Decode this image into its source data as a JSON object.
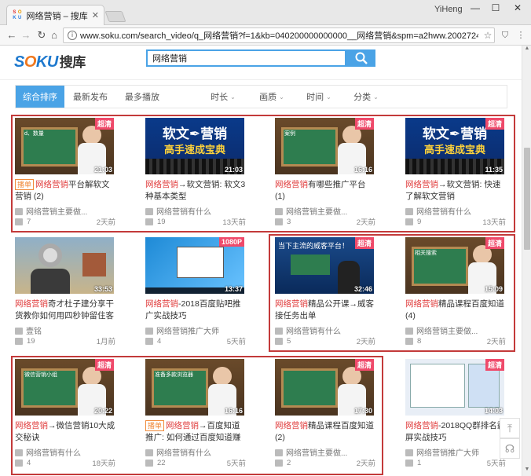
{
  "browser": {
    "tab_title": "网络营销 – 搜库",
    "favicon_letters": [
      "S",
      "O",
      "K",
      "U"
    ],
    "user_name": "YiHeng",
    "url": "www.soku.com/search_video/q_网络营销?f=1&kb=040200000000000__网络营销&spm=a2hww.20027244.#qheader_s..."
  },
  "site": {
    "logo_s": "S",
    "logo_o": "O",
    "logo_ku": "KU",
    "logo_cn": "搜库",
    "search_value": "网络营销"
  },
  "filters": [
    {
      "label": "综合排序",
      "active": true,
      "caret": false
    },
    {
      "label": "最新发布",
      "active": false,
      "caret": false
    },
    {
      "label": "最多播放",
      "active": false,
      "caret": false
    },
    {
      "label": "时长",
      "active": false,
      "caret": true
    },
    {
      "label": "画质",
      "active": false,
      "caret": true
    },
    {
      "label": "时间",
      "active": false,
      "caret": true
    },
    {
      "label": "分类",
      "active": false,
      "caret": true
    }
  ],
  "videos": [
    {
      "tag": "播单",
      "title_hl": "网络营销",
      "title_rest": "平台解软文营销 (2)",
      "author": "网络营销主要做...",
      "count": "7",
      "ago": "2天前",
      "badge": "超清",
      "duration": "21:03",
      "thumb_text": "d、数量",
      "thumb": "board"
    },
    {
      "tag": "",
      "title_hl": "网络营销",
      "title_rest": "→软文营销: 软文3种基本类型",
      "author": "网络营销有什么",
      "count": "19",
      "ago": "13天前",
      "badge": "",
      "duration": "21:03",
      "thumb_text": "软文✒营销",
      "thumb_text2": "高手速成宝典",
      "thumb": "banner"
    },
    {
      "tag": "",
      "title_hl": "网络营销",
      "title_rest": "有哪些推广平台 (1)",
      "author": "网络营销主要做...",
      "count": "3",
      "ago": "2天前",
      "badge": "超清",
      "duration": "16:16",
      "thumb_text": "案例",
      "thumb": "board"
    },
    {
      "tag": "",
      "title_hl": "网络营销",
      "title_rest": "→软文营销: 快速了解软文营销",
      "author": "网络营销有什么",
      "count": "9",
      "ago": "13天前",
      "badge": "超清",
      "duration": "11:35",
      "thumb_text": "软文✒营销",
      "thumb_text2": "高手速成宝典",
      "thumb": "banner"
    },
    {
      "tag": "",
      "title_hl": "网络营销",
      "title_rest": "奇才杜子建分享干货教你如何用四秒钟留住客",
      "author": "壹铭",
      "count": "19",
      "ago": "1月前",
      "badge": "",
      "duration": "33:53",
      "thumb_text": "",
      "thumb": "speaker"
    },
    {
      "tag": "",
      "title_hl": "网络营销",
      "title_rest": "-2018百度贴吧推广实战技巧",
      "author": "网络营销推广大师",
      "count": "4",
      "ago": "5天前",
      "badge": "1080P",
      "duration": "13:37",
      "thumb_text": "",
      "thumb": "desktop"
    },
    {
      "tag": "",
      "title_hl": "网络营销",
      "title_rest": "精品公开课→威客接任务出单",
      "author": "网络营销有什么",
      "count": "5",
      "ago": "2天前",
      "badge": "超清",
      "duration": "32:46",
      "thumb_text": "当下主流的威客平台！",
      "thumb": "talk"
    },
    {
      "tag": "",
      "title_hl": "网络营销",
      "title_rest": "精品课程百度知道 (4)",
      "author": "网络营销主要做...",
      "count": "8",
      "ago": "2天前",
      "badge": "超清",
      "duration": "15:09",
      "thumb_text": "相关搜索",
      "thumb": "board"
    },
    {
      "tag": "",
      "title_hl": "网络营销",
      "title_rest": "→微信营销10大成交秘诀",
      "author": "网络营销有什么",
      "count": "4",
      "ago": "18天前",
      "badge": "超清",
      "duration": "20:22",
      "thumb_text": "微信营销小组",
      "thumb": "board"
    },
    {
      "tag": "播单",
      "title_hl": "网络营销",
      "title_rest": "→百度知道推广: 如何通过百度知道赚钱",
      "author": "网络营销有什么",
      "count": "22",
      "ago": "5天前",
      "badge": "",
      "duration": "16:16",
      "thumb_text": "准备多款浏览器",
      "thumb": "board"
    },
    {
      "tag": "",
      "title_hl": "网络营销",
      "title_rest": "精品课程百度知道 (2)",
      "author": "网络营销主要做...",
      "count": "2",
      "ago": "2天前",
      "badge": "超清",
      "duration": "17:30",
      "thumb_text": "",
      "thumb": "board"
    },
    {
      "tag": "",
      "title_hl": "网络营销",
      "title_rest": "-2018QQ群排名霸屏实战技巧",
      "author": "网络营销推广大师",
      "count": "1",
      "ago": "5天前",
      "badge": "超清",
      "duration": "14:03",
      "thumb_text": "",
      "thumb": "screen"
    }
  ],
  "colors": {
    "accent": "#4aa3e6",
    "highlight": "#e03c3c",
    "badge": "#ef4a6a",
    "annotation": "#c33a3a"
  }
}
